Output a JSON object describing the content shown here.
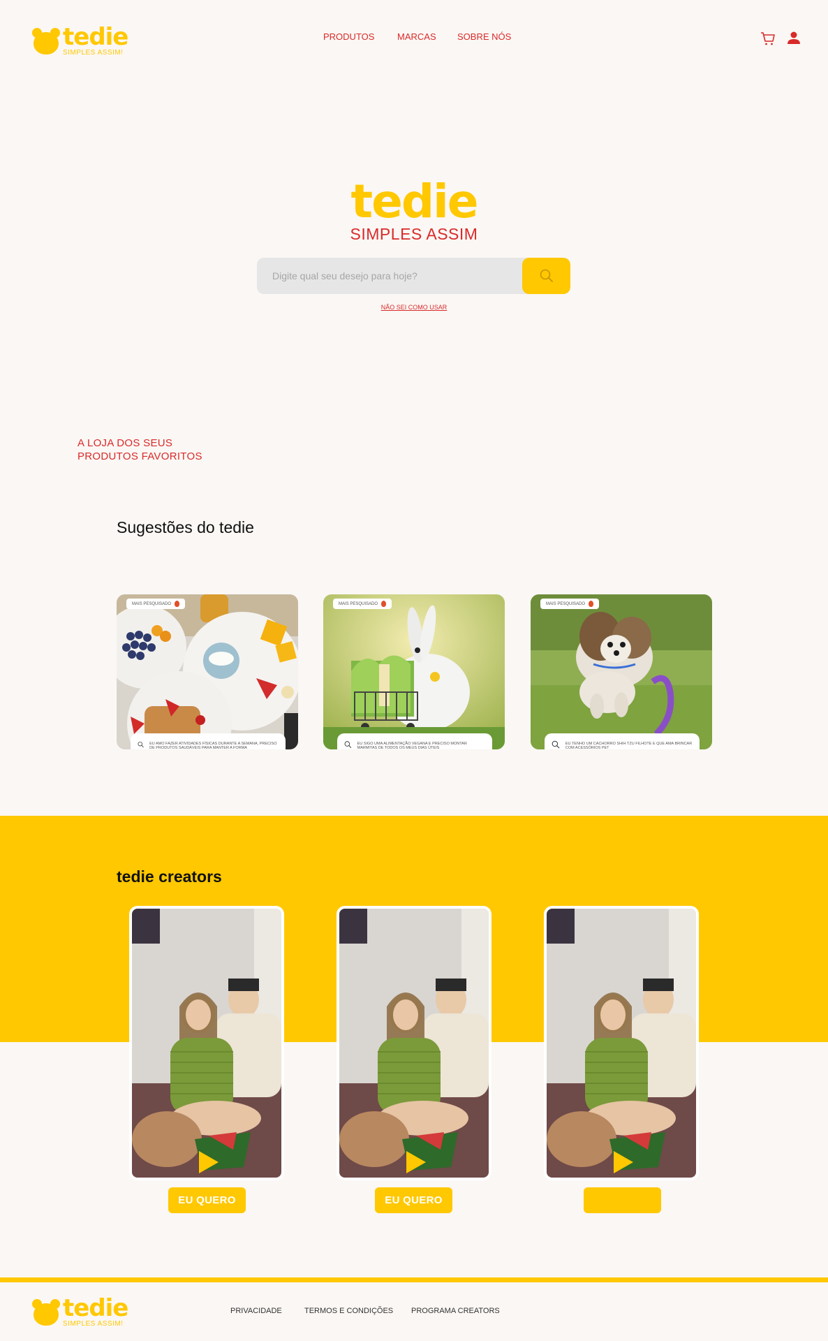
{
  "brand": {
    "name": "tedie",
    "tagline": "SIMPLES ASSIM!"
  },
  "nav": {
    "products": "PRODUTOS",
    "brands": "MARCAS",
    "about": "SOBRE NÓS"
  },
  "header_icons": {
    "cart": "cart-icon",
    "user": "user-icon"
  },
  "hero": {
    "name": "tedie",
    "tagline": "SIMPLES ASSIM",
    "search_placeholder": "Digite qual seu desejo para hoje?",
    "help_link": "NÃO SEI COMO USAR"
  },
  "store_tagline": {
    "line1": "A LOJA DOS SEUS",
    "line2": "PRODUTOS FAVORITOS"
  },
  "suggestions": {
    "title": "Sugestões do tedie",
    "cards": [
      {
        "badge": "MAIS PESQUISADO",
        "query": "EU AMO FAZER ATIVIDADES FÍSICAS DURANTE A SEMANA, PRECISO DE PRODUTOS SAUDÁVEIS PARA MANTER A FORMA"
      },
      {
        "badge": "MAIS PESQUISADO",
        "query": "EU SIGO UMA ALIMENTAÇÃO VEGANA E PRECISO MONTAR MARMITAS DE TODOS OS MEUS DIAS ÚTEIS"
      },
      {
        "badge": "MAIS PESQUISADO",
        "query": "EU TENHO UM CACHORRO SHIH TZU FILHOTE E QUE AMA BRINCAR COM ACESSÓRIOS PET"
      }
    ]
  },
  "creators": {
    "title": "tedie creators",
    "buttons": [
      "EU QUERO",
      "EU QUERO",
      ""
    ]
  },
  "footer": {
    "brand": "tedie",
    "tagline": "SIMPLES ASSIM!",
    "links": [
      "PRIVACIDADE",
      "TERMOS E CONDIÇÕES",
      "PROGRAMA CREATORS"
    ]
  },
  "colors": {
    "brand_yellow": "#ffc800",
    "brand_red": "#d92a2a",
    "background": "#faf7f4"
  }
}
